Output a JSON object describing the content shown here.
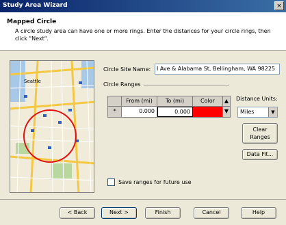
{
  "window": {
    "title": "Study Area Wizard",
    "close_glyph": "×"
  },
  "header": {
    "title": "Mapped Circle",
    "description": "A circle study area can have one or more rings.  Enter the distances for your circle rings, then click \"Next\"."
  },
  "map": {
    "city_label": "Seattle",
    "circle_color": "#e01010",
    "road_color": "#f5c842",
    "water_color": "#a8c8e8",
    "park_color": "#b8d8a0"
  },
  "form": {
    "site_name_label": "Circle Site Name:",
    "site_name_value": "I Ave & Alabama St, Bellingham, WA 98225",
    "circle_ranges_label": "Circle Ranges",
    "grid": {
      "headers": {
        "from": "From (mi)",
        "to": "To (mi)",
        "color": "Color"
      },
      "row": {
        "marker": "*",
        "from": "0.000",
        "to": "0.000",
        "color": "#ff0000"
      }
    },
    "distance_units_label": "Distance Units:",
    "distance_units_value": "Miles",
    "clear_ranges_label_1": "Clear",
    "clear_ranges_label_2": "Ranges",
    "data_fit_label": "Data Fit...",
    "save_ranges_label": "Save ranges for future use"
  },
  "footer": {
    "back": "< Back",
    "next": "Next >",
    "finish": "Finish",
    "cancel": "Cancel",
    "help": "Help"
  }
}
